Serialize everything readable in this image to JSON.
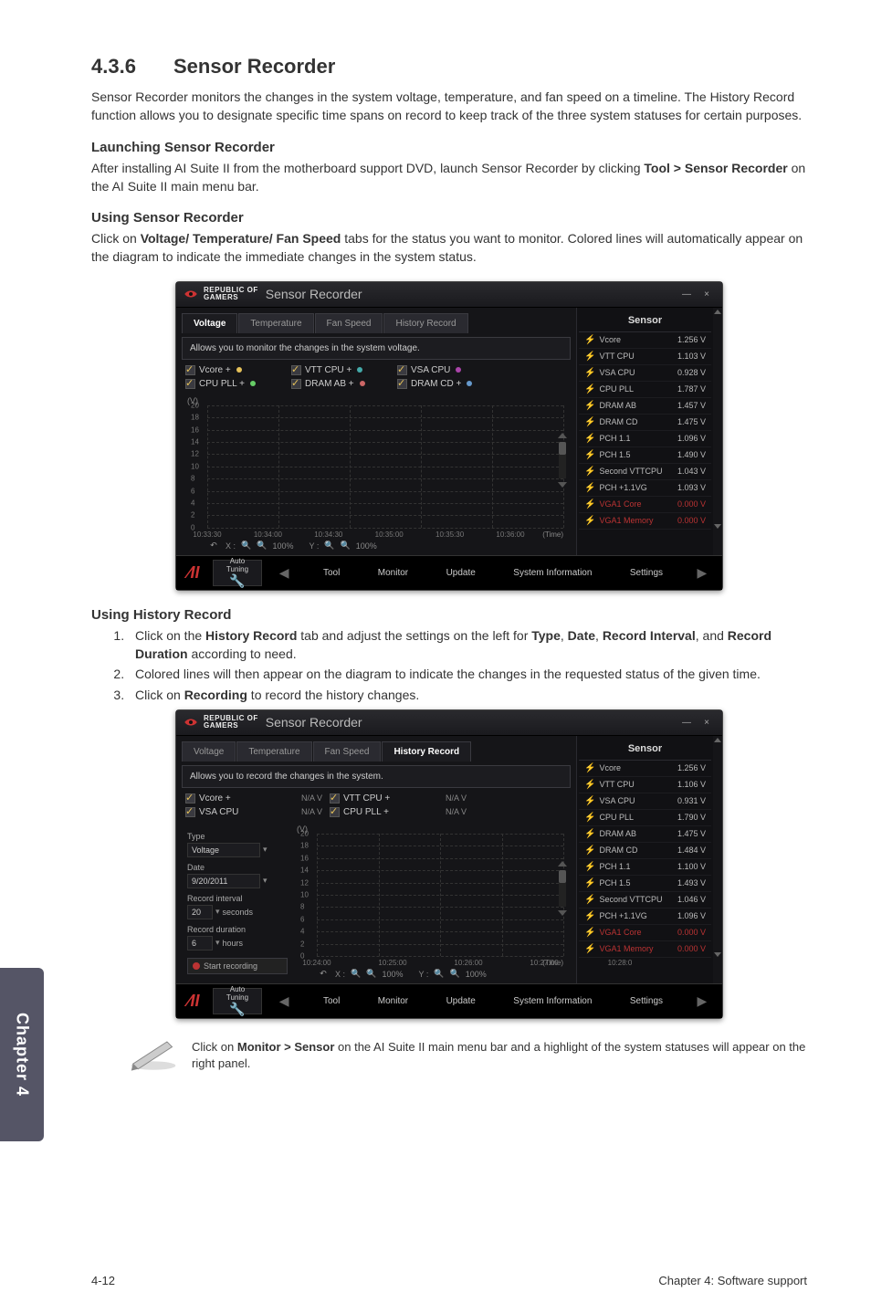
{
  "tab_label": "Chapter 4",
  "section": {
    "number": "4.3.6",
    "title": "Sensor Recorder"
  },
  "intro": "Sensor Recorder monitors the changes in the system voltage, temperature, and fan speed on a timeline. The History Record function allows you to designate specific time spans on record to keep track of the three system statuses for certain purposes.",
  "launch_head": "Launching Sensor Recorder",
  "launch_body_pre": "After installing AI Suite II from the motherboard support DVD, launch Sensor Recorder by clicking ",
  "launch_body_bold": "Tool > Sensor Recorder",
  "launch_body_post": " on the AI Suite II main menu bar.",
  "using_head": "Using Sensor Recorder",
  "using_body_pre": "Click on ",
  "using_body_bold": "Voltage/ Temperature/ Fan Speed",
  "using_body_post": " tabs for the status you want to monitor. Colored lines will automatically appear on the diagram to indicate the immediate changes in the system status.",
  "history_head": "Using History Record",
  "steps": {
    "s1_a": "Click on the ",
    "s1_b": "History Record",
    "s1_c": " tab and adjust the settings on the left for ",
    "s1_d": "Type",
    "s1_e": ", ",
    "s1_f": "Date",
    "s1_g": ", ",
    "s1_h": "Record Interval",
    "s1_i": ", and ",
    "s1_j": "Record Duration",
    "s1_k": " according to need.",
    "s2": "Colored lines will then appear on the diagram to indicate the changes in the requested status of the given time.",
    "s3_a": "Click on ",
    "s3_b": "Recording",
    "s3_c": " to record the history changes."
  },
  "note_pre": "Click on ",
  "note_bold": "Monitor > Sensor",
  "note_post": " on the AI Suite II main menu bar and a highlight of the system statuses will appear on the right panel.",
  "footer": {
    "left": "4-12",
    "right": "Chapter 4: Software support"
  },
  "app": {
    "brand_line1": "REPUBLIC OF",
    "brand_line2": "GAMERS",
    "title": "Sensor Recorder",
    "min": "—",
    "close": "×",
    "tabs": {
      "voltage": "Voltage",
      "temperature": "Temperature",
      "fanspeed": "Fan Speed",
      "history": "History Record"
    },
    "desc_voltage": "Allows you to monitor the changes in the system voltage.",
    "desc_history": "Allows you to record the changes in the system.",
    "checks1": {
      "vcore": "Vcore +",
      "vtt": "VTT CPU +",
      "vsa": "VSA CPU",
      "cpupll": "CPU PLL +",
      "dramab": "DRAM AB +",
      "dramcd": "DRAM CD +"
    },
    "checks2": {
      "vcore": "Vcore +",
      "vtt": "VTT CPU +",
      "vsa": "VSA CPU",
      "cpupll": "CPU PLL +",
      "na": "N/A  V"
    },
    "axis": {
      "ylabel": "(V)",
      "yticks1": [
        "20",
        "18",
        "16",
        "14",
        "12",
        "10",
        "8",
        "6",
        "4",
        "2",
        "0"
      ],
      "xticks1": [
        "10:33:30",
        "10:34:00",
        "10:34:30",
        "10:35:00",
        "10:35:30",
        "10:36:00"
      ],
      "yticks2": [
        "20",
        "18",
        "16",
        "14",
        "12",
        "10",
        "8",
        "6",
        "4",
        "2",
        "0"
      ],
      "xticks2": [
        "10:24:00",
        "10:25:00",
        "10:26:00",
        "10:27:00",
        "10:28:0"
      ],
      "time": "(Time)"
    },
    "zoom": {
      "undo": "↶",
      "xlabel": "X :",
      "ylabel": "Y :",
      "pct": "100%"
    },
    "sensor_head": "Sensor",
    "sensors1": [
      {
        "name": "Vcore",
        "val": "1.256 V"
      },
      {
        "name": "VTT CPU",
        "val": "1.103 V"
      },
      {
        "name": "VSA CPU",
        "val": "0.928 V"
      },
      {
        "name": "CPU PLL",
        "val": "1.787 V"
      },
      {
        "name": "DRAM AB",
        "val": "1.457 V"
      },
      {
        "name": "DRAM CD",
        "val": "1.475 V"
      },
      {
        "name": "PCH 1.1",
        "val": "1.096 V"
      },
      {
        "name": "PCH 1.5",
        "val": "1.490 V"
      },
      {
        "name": "Second VTTCPU",
        "val": "1.043 V"
      },
      {
        "name": "PCH +1.1VG",
        "val": "1.093 V"
      },
      {
        "name": "VGA1 Core",
        "val": "0.000 V",
        "red": true
      },
      {
        "name": "VGA1 Memory",
        "val": "0.000 V",
        "red": true
      }
    ],
    "sensors2": [
      {
        "name": "Vcore",
        "val": "1.256 V"
      },
      {
        "name": "VTT CPU",
        "val": "1.106 V"
      },
      {
        "name": "VSA CPU",
        "val": "0.931 V"
      },
      {
        "name": "CPU PLL",
        "val": "1.790 V"
      },
      {
        "name": "DRAM AB",
        "val": "1.475 V"
      },
      {
        "name": "DRAM CD",
        "val": "1.484 V"
      },
      {
        "name": "PCH 1.1",
        "val": "1.100 V"
      },
      {
        "name": "PCH 1.5",
        "val": "1.493 V"
      },
      {
        "name": "Second VTTCPU",
        "val": "1.046 V"
      },
      {
        "name": "PCH +1.1VG",
        "val": "1.096 V"
      },
      {
        "name": "VGA1 Core",
        "val": "0.000 V",
        "red": true
      },
      {
        "name": "VGA1 Memory",
        "val": "0.000 V",
        "red": true
      }
    ],
    "bottom": {
      "logo": "⁄II",
      "auto1": "Auto",
      "auto2": "Tuning",
      "btns": [
        "Tool",
        "Monitor",
        "Update",
        "System Information",
        "Settings"
      ]
    },
    "hist": {
      "type_lbl": "Type",
      "type_val": "Voltage",
      "date_lbl": "Date",
      "date_val": "9/20/2011",
      "interval_lbl": "Record interval",
      "interval_val": "20",
      "interval_unit": "seconds",
      "duration_lbl": "Record duration",
      "duration_val": "6",
      "duration_unit": "hours",
      "start": "Start recording"
    }
  }
}
